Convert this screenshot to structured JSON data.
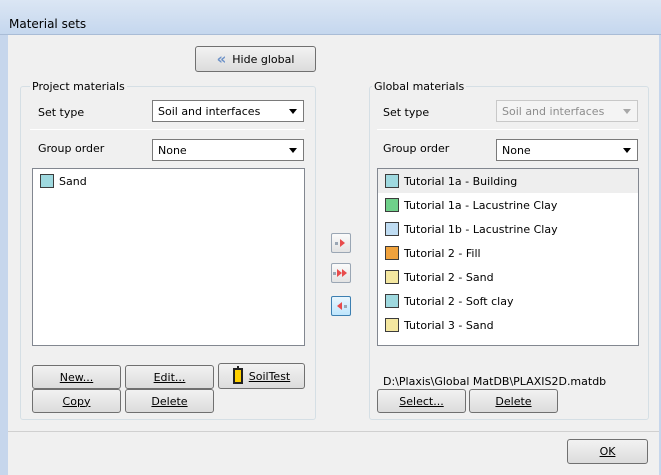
{
  "window": {
    "title": "Material sets"
  },
  "hide_global_button": {
    "label": "Hide global",
    "icon": "double-chevron-left-icon",
    "icon_color": "#6d92c8"
  },
  "project": {
    "group_title": "Project materials",
    "set_type_label": "Set type",
    "set_type_value": "Soil and interfaces",
    "group_order_label": "Group order",
    "group_order_value": "None",
    "materials": [
      {
        "name": "Sand",
        "color": "#9fd9df"
      }
    ],
    "buttons": {
      "new": "New...",
      "edit": "Edit...",
      "soiltest": "SoilTest",
      "copy": "Copy",
      "delete": "Delete"
    }
  },
  "transfer_buttons": [
    {
      "name": "copy-to-global-icon",
      "arrow_color": "#e84b4b"
    },
    {
      "name": "copy-all-to-global-icon",
      "arrow_color": "#e84b4b"
    },
    {
      "name": "copy-to-project-icon",
      "arrow_color": "#e84b4b"
    }
  ],
  "global": {
    "group_title": "Global materials",
    "set_type_label": "Set type",
    "set_type_value": "Soil and interfaces",
    "group_order_label": "Group order",
    "group_order_value": "None",
    "materials": [
      {
        "name": "Tutorial 1a - Building",
        "color": "#9fd9df",
        "selected": true
      },
      {
        "name": "Tutorial 1a - Lacustrine Clay",
        "color": "#6fd08a"
      },
      {
        "name": "Tutorial 1b - Lacustrine Clay",
        "color": "#bfdcf2"
      },
      {
        "name": "Tutorial 2 - Fill",
        "color": "#f0a23c"
      },
      {
        "name": "Tutorial 2 - Sand",
        "color": "#f4e7a0"
      },
      {
        "name": "Tutorial 2 - Soft clay",
        "color": "#9fd9df"
      },
      {
        "name": "Tutorial 3 - Sand",
        "color": "#f4e7a0"
      }
    ],
    "db_path": "D:\\Plaxis\\Global MatDB\\PLAXIS2D.matdb",
    "buttons": {
      "select": "Select...",
      "delete": "Delete"
    }
  },
  "ok_button": {
    "label": "OK"
  }
}
